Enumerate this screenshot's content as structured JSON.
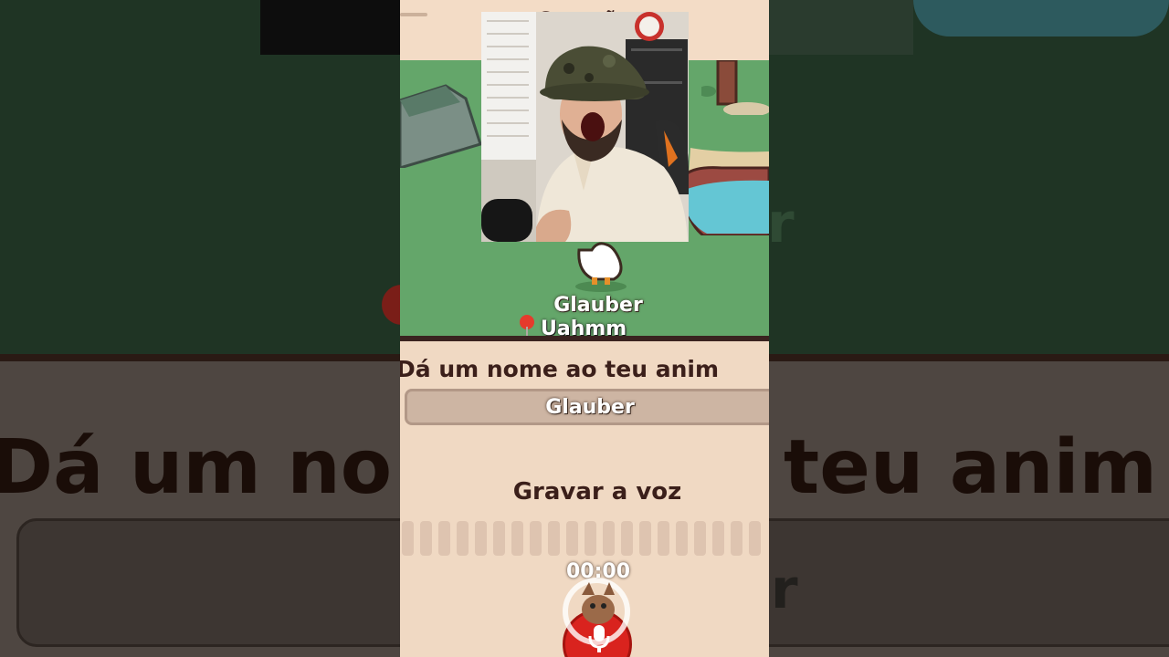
{
  "header": {
    "title": "Ce           oção"
  },
  "scene": {
    "pet_name": "Glauber",
    "caption": "Uahmm"
  },
  "form": {
    "prompt": "Dá um nome ao teu anim",
    "name_value": "Glauber",
    "record_label": "Gravar a voz",
    "timer": "00:00"
  },
  "background": {
    "big_text_left": "Dá um no",
    "big_text_right": "teu anim"
  },
  "colors": {
    "accent_red": "#d9231e",
    "grass": "#64a66a",
    "panel": "#f0d9c3",
    "text_dark": "#3b1f1a"
  },
  "icons": [
    "pin-icon",
    "mic-icon",
    "goose-icon",
    "watermark-logo"
  ]
}
